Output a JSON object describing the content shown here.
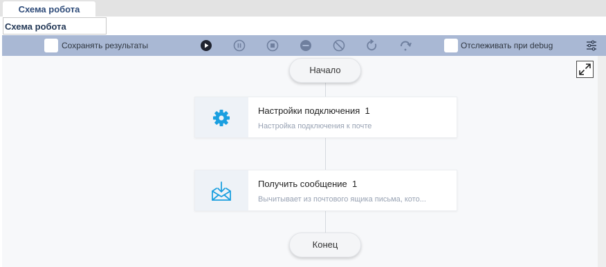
{
  "tab": {
    "label": "Схема робота"
  },
  "title_field": {
    "value": "Схема робота"
  },
  "toolbar": {
    "save_results_label": "Сохранять результаты",
    "track_debug_label": "Отслеживать при debug",
    "buttons": [
      "play-icon",
      "pause-icon",
      "stop-icon",
      "minus-circle-icon",
      "cancel-icon",
      "restart-icon",
      "redo-icon"
    ],
    "settings_icon": "sliders-icon"
  },
  "flow": {
    "start_label": "Начало",
    "end_label": "Конец",
    "nodes": [
      {
        "title": "Настройки подключения",
        "index": "1",
        "subtitle": "Настройка подключения к почте",
        "icon": "gear-icon"
      },
      {
        "title": "Получить сообщение",
        "index": "1",
        "subtitle": "Вычитывает из почтового ящика письма, кото...",
        "icon": "envelope-download-icon"
      }
    ]
  },
  "colors": {
    "accent": "#1a9fe0",
    "toolbar": "#a9b8d4",
    "tab_text": "#2d4a78"
  }
}
